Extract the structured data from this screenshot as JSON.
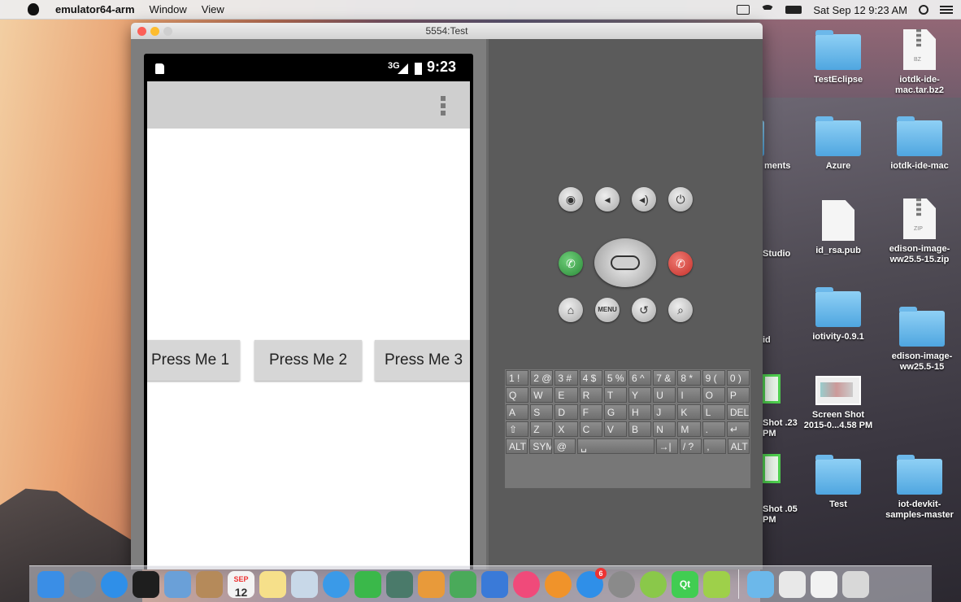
{
  "menubar": {
    "app_name": "emulator64-arm",
    "items": [
      "Window",
      "View"
    ],
    "clock": "Sat Sep 12  9:23 AM"
  },
  "emulator": {
    "title": "5554:Test",
    "status_signal": "3G",
    "status_time": "9:23",
    "buttons": [
      "Press Me 1",
      "Press Me 2",
      "Press Me 3"
    ],
    "controls": {
      "menu_label": "MENU"
    },
    "keyboard": {
      "row1": [
        "1 !",
        "2 @",
        "3 #",
        "4 $",
        "5 %",
        "6 ^",
        "7 &",
        "8 *",
        "9 (",
        "0 )"
      ],
      "row2": [
        "Q",
        "W",
        "E",
        "R",
        "T",
        "Y",
        "U",
        "I",
        "O",
        "P"
      ],
      "row3": [
        "A",
        "S",
        "D",
        "F",
        "G",
        "H",
        "J",
        "K",
        "L",
        "DEL"
      ],
      "row4": [
        "⇧",
        "Z",
        "X",
        "C",
        "V",
        "B",
        "N",
        "M",
        ".",
        "↵"
      ],
      "row5": [
        "ALT",
        "SYM",
        "@",
        "␣",
        "→|",
        "/ ?",
        ",",
        "ALT"
      ]
    }
  },
  "desktop": {
    "icons": [
      {
        "label": "TestEclipse",
        "kind": "folder"
      },
      {
        "label": "iotdk-ide-mac.tar.bz2",
        "kind": "archive",
        "tag": "BZ"
      },
      {
        "label": "ments",
        "kind": "folder"
      },
      {
        "label": "Azure",
        "kind": "folder"
      },
      {
        "label": "iotdk-ide-mac",
        "kind": "folder"
      },
      {
        "label": "Studio",
        "kind": "folder"
      },
      {
        "label": "id_rsa.pub",
        "kind": "document"
      },
      {
        "label": "edison-image-ww25.5-15.zip",
        "kind": "archive",
        "tag": "ZIP"
      },
      {
        "label": "id",
        "kind": "folder"
      },
      {
        "label": "iotivity-0.9.1",
        "kind": "folder"
      },
      {
        "label": "edison-image-ww25.5-15",
        "kind": "folder"
      },
      {
        "label": "Shot .23 PM",
        "kind": "screenshot"
      },
      {
        "label": "Screen Shot 2015-0...4.58 PM",
        "kind": "screenshot"
      },
      {
        "label": "Shot .05 PM",
        "kind": "screenshot"
      },
      {
        "label": "Test",
        "kind": "folder"
      },
      {
        "label": "iot-devkit-samples-master",
        "kind": "folder"
      }
    ]
  },
  "dock": {
    "calendar_day": "12",
    "calendar_month": "SEP",
    "app_store_badge": "6",
    "qt_label": "Qt"
  },
  "colors": {
    "folder_blue": "#5aaee6",
    "window_gray": "#5b5b5b",
    "button_gray": "#d6d6d6"
  }
}
